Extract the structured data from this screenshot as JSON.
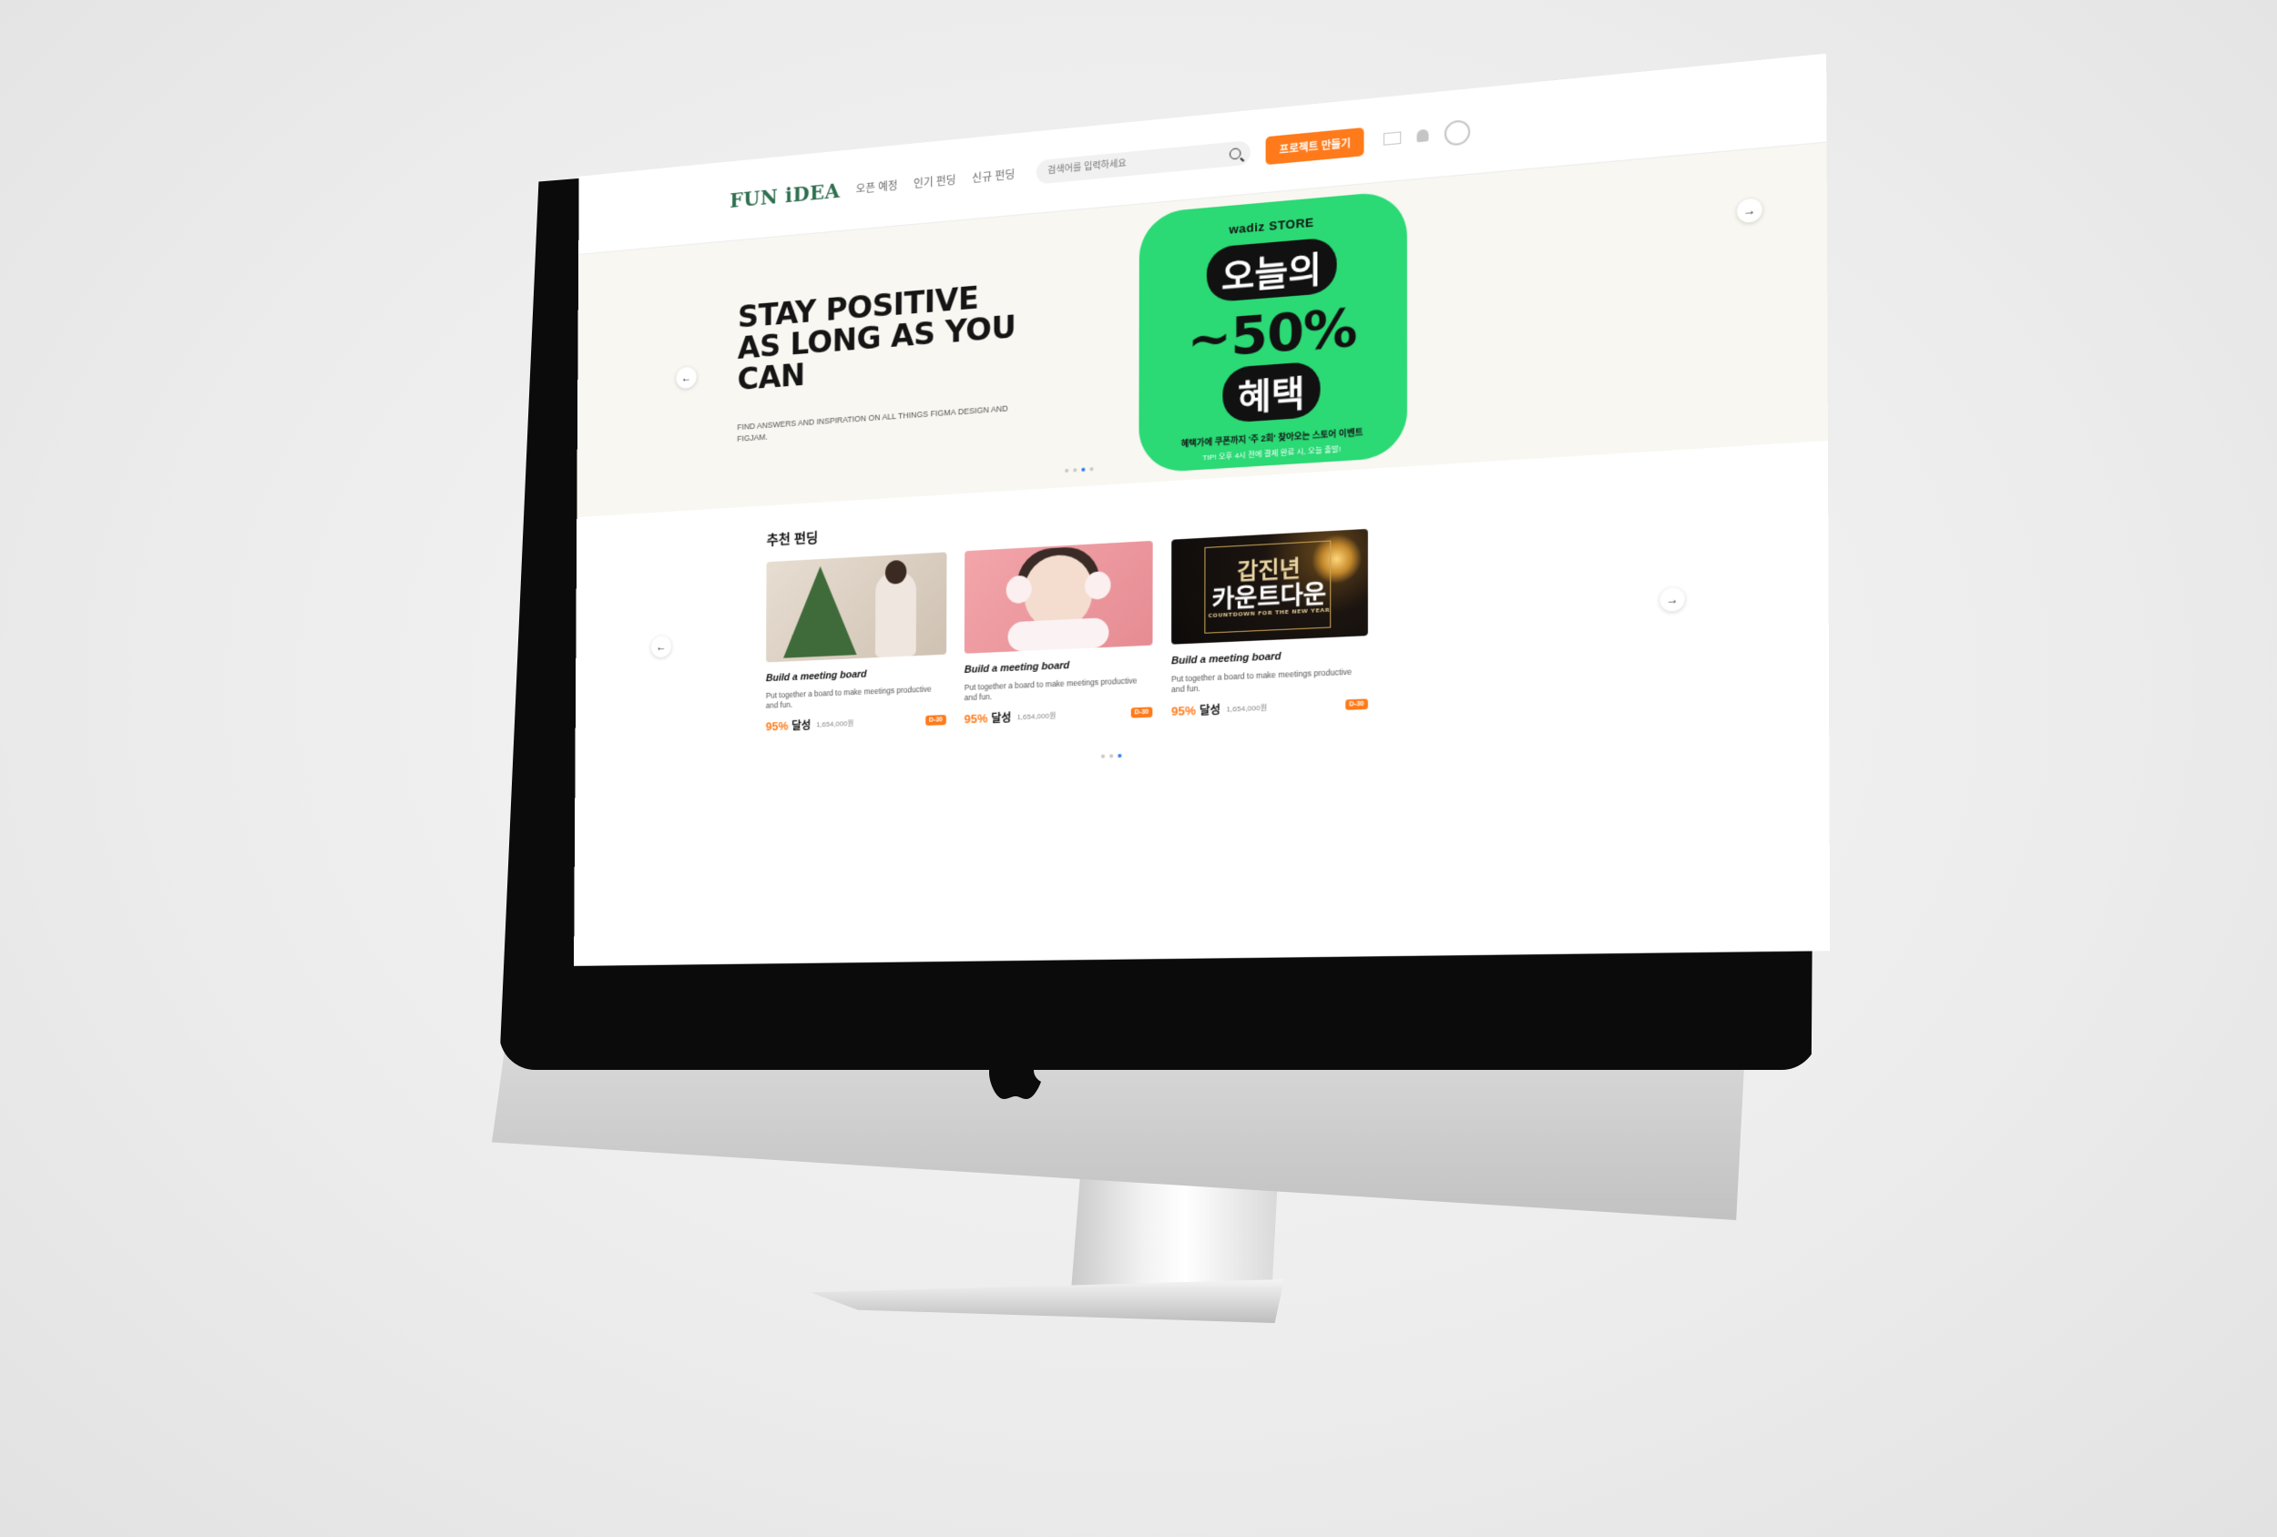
{
  "header": {
    "brand": "FUN iDEA",
    "nav": [
      "오픈 예정",
      "인기 펀딩",
      "신규 펀딩"
    ],
    "search_placeholder": "검색어를 입력하세요",
    "cta_label": "프로젝트 만들기"
  },
  "hero": {
    "title": "STAY POSITIVE AS LONG AS YOU CAN",
    "subtitle": "FIND ANSWERS AND INSPIRATION ON ALL THINGS FIGMA DESIGN AND FIGJAM.",
    "promo": {
      "brand": "wadiz STORE",
      "line1": "오늘의",
      "line2": "~50%",
      "line3": "혜택",
      "note": "혜택가에 쿠폰까지 '주 2회' 찾아오는 스토어 이벤트",
      "tip": "TIP! 오후 4시 전에 결제 완료 시, 오늘 출발!"
    },
    "prev_arrow": "←",
    "next_arrow": "→"
  },
  "recommended": {
    "title": "추천 펀딩",
    "prev_arrow": "←",
    "next_arrow": "→",
    "cards": [
      {
        "title": "Build a meeting board",
        "desc": "Put together a board to make meetings productive and fun.",
        "percent": "95%",
        "achieved": "달성",
        "amount": "1,654,000원",
        "badge": "D-30"
      },
      {
        "title": "Build a meeting board",
        "desc": "Put together a board to make meetings productive and fun.",
        "percent": "95%",
        "achieved": "달성",
        "amount": "1,654,000원",
        "badge": "D-30"
      },
      {
        "title": "Build a meeting board",
        "desc": "Put together a board to make meetings productive and fun.",
        "percent": "95%",
        "achieved": "달성",
        "amount": "1,654,000원",
        "badge": "D-30",
        "image_text": {
          "line1": "갑진년",
          "line2": "카운트다운",
          "line3": "COUNTDOWN FOR THE NEW YEAR"
        }
      }
    ]
  },
  "colors": {
    "accent": "#ff7a1a",
    "brand": "#2f6f4f",
    "promo": "#2bd975",
    "hero_bg": "#f8f7f1",
    "dot_active": "#2f7cf6"
  },
  "icons": [
    "search-icon",
    "mail-icon",
    "bell-icon",
    "avatar-icon",
    "apple-logo"
  ]
}
